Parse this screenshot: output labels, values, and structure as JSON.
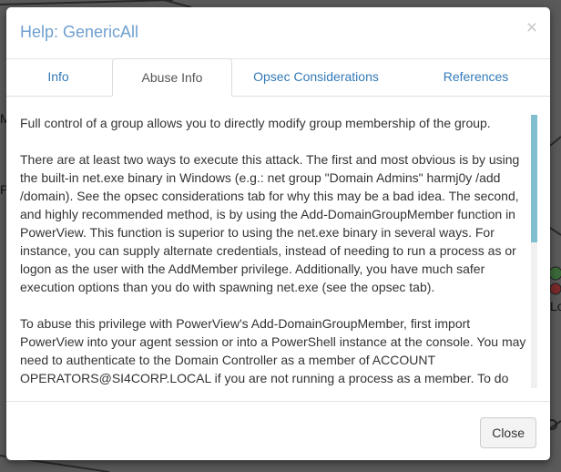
{
  "dialog": {
    "title": "Help: GenericAll",
    "close_symbol": "×",
    "tabs": [
      {
        "label": "Info",
        "active": false
      },
      {
        "label": "Abuse Info",
        "active": true
      },
      {
        "label": "Opsec Considerations",
        "active": false
      },
      {
        "label": "References",
        "active": false
      }
    ],
    "paragraphs": [
      "Full control of a group allows you to directly modify group membership of the group.",
      "There are at least two ways to execute this attack. The first and most obvious is by using the built-in net.exe binary in Windows (e.g.: net group \"Domain Admins\" harmj0y /add /domain). See the opsec considerations tab for why this may be a bad idea. The second, and highly recommended method, is by using the Add-DomainGroupMember function in PowerView. This function is superior to using the net.exe binary in several ways. For instance, you can supply alternate credentials, instead of needing to run a process as or logon as the user with the AddMember privilege. Additionally, you have much safer execution options than you do with spawning net.exe (see the opsec tab).",
      "To abuse this privilege with PowerView's Add-DomainGroupMember, first import PowerView into your agent session or into a PowerShell instance at the console. You may need to authenticate to the Domain Controller as a member of ACCOUNT OPERATORS@SI4CORP.LOCAL if you are not running a process as a member. To do"
    ],
    "footer_button": "Close"
  },
  "background": {
    "fragments": [
      "M",
      "P",
      "Lo"
    ]
  },
  "colors": {
    "backdrop": "#5a5a5a",
    "title": "#6f9fd0",
    "tab_link": "#337ab7",
    "scroll_thumb": "#7fbfcf"
  }
}
